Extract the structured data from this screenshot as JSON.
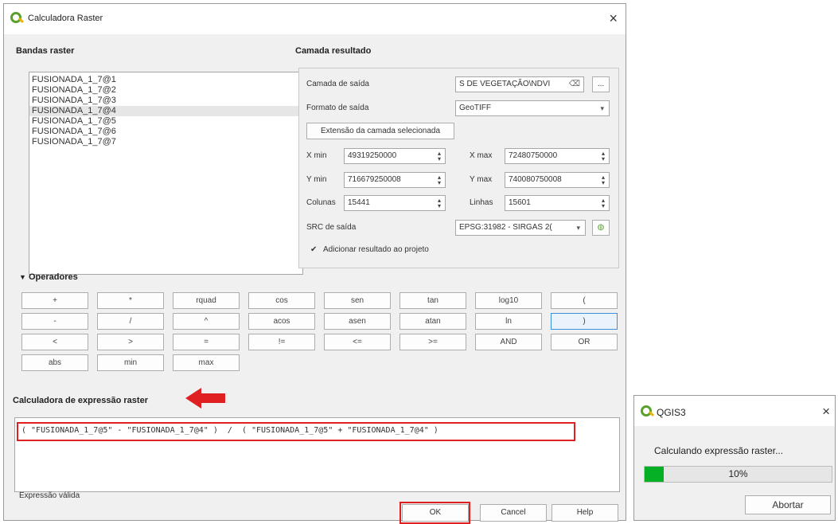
{
  "dialog": {
    "title": "Calculadora Raster",
    "close_label": "×"
  },
  "bands": {
    "title": "Bandas raster",
    "items": [
      "FUSIONADA_1_7@1",
      "FUSIONADA_1_7@2",
      "FUSIONADA_1_7@3",
      "FUSIONADA_1_7@4",
      "FUSIONADA_1_7@5",
      "FUSIONADA_1_7@6",
      "FUSIONADA_1_7@7"
    ],
    "selected_index": 3
  },
  "result": {
    "title": "Camada resultado",
    "output_layer_label": "Camada de saída",
    "output_layer_value": "S DE VEGETAÇÃO\\NDVI",
    "browse_label": "...",
    "format_label": "Formato de saída",
    "format_value": "GeoTIFF",
    "extent_button": "Extensão da camada selecionada",
    "xmin_label": "X min",
    "xmin_value": "49319250000",
    "xmax_label": "X max",
    "xmax_value": "72480750000",
    "ymin_label": "Y min",
    "ymin_value": "716679250008",
    "ymax_label": "Y max",
    "ymax_value": "740080750008",
    "columns_label": "Colunas",
    "columns_value": "15441",
    "rows_label": "Linhas",
    "rows_value": "15601",
    "crs_label": "SRC de saída",
    "crs_value": "EPSG:31982 - SIRGAS 2(",
    "add_result_label": "Adicionar resultado ao projeto",
    "add_result_checked": true
  },
  "operators": {
    "title": "Operadores",
    "rows": [
      [
        "+",
        "*",
        "rquad",
        "cos",
        "sen",
        "tan",
        "log10",
        "("
      ],
      [
        "-",
        "/",
        "^",
        "acos",
        "asen",
        "atan",
        "ln",
        ")"
      ],
      [
        "<",
        ">",
        "=",
        "!=",
        "<=",
        ">=",
        "AND",
        "OR"
      ],
      [
        "abs",
        "min",
        "max"
      ]
    ]
  },
  "expression": {
    "title": "Calculadora de expressão raster",
    "text": "( \"FUSIONADA_1_7@5\" - \"FUSIONADA_1_7@4\" )  /  ( \"FUSIONADA_1_7@5\" + \"FUSIONADA_1_7@4\" )",
    "validity": "Expressão válida"
  },
  "buttons": {
    "ok": "OK",
    "cancel": "Cancel",
    "help": "Help"
  },
  "progress": {
    "title": "QGIS3",
    "close_label": "×",
    "message": "Calculando expressão raster...",
    "percent": 10,
    "percent_text": "10%",
    "abort": "Abortar"
  },
  "colors": {
    "highlight_red": "#e02020",
    "progress_green": "#06b025",
    "qgis_green": "#5aa02c",
    "qgis_yellow": "#e8b20a"
  }
}
